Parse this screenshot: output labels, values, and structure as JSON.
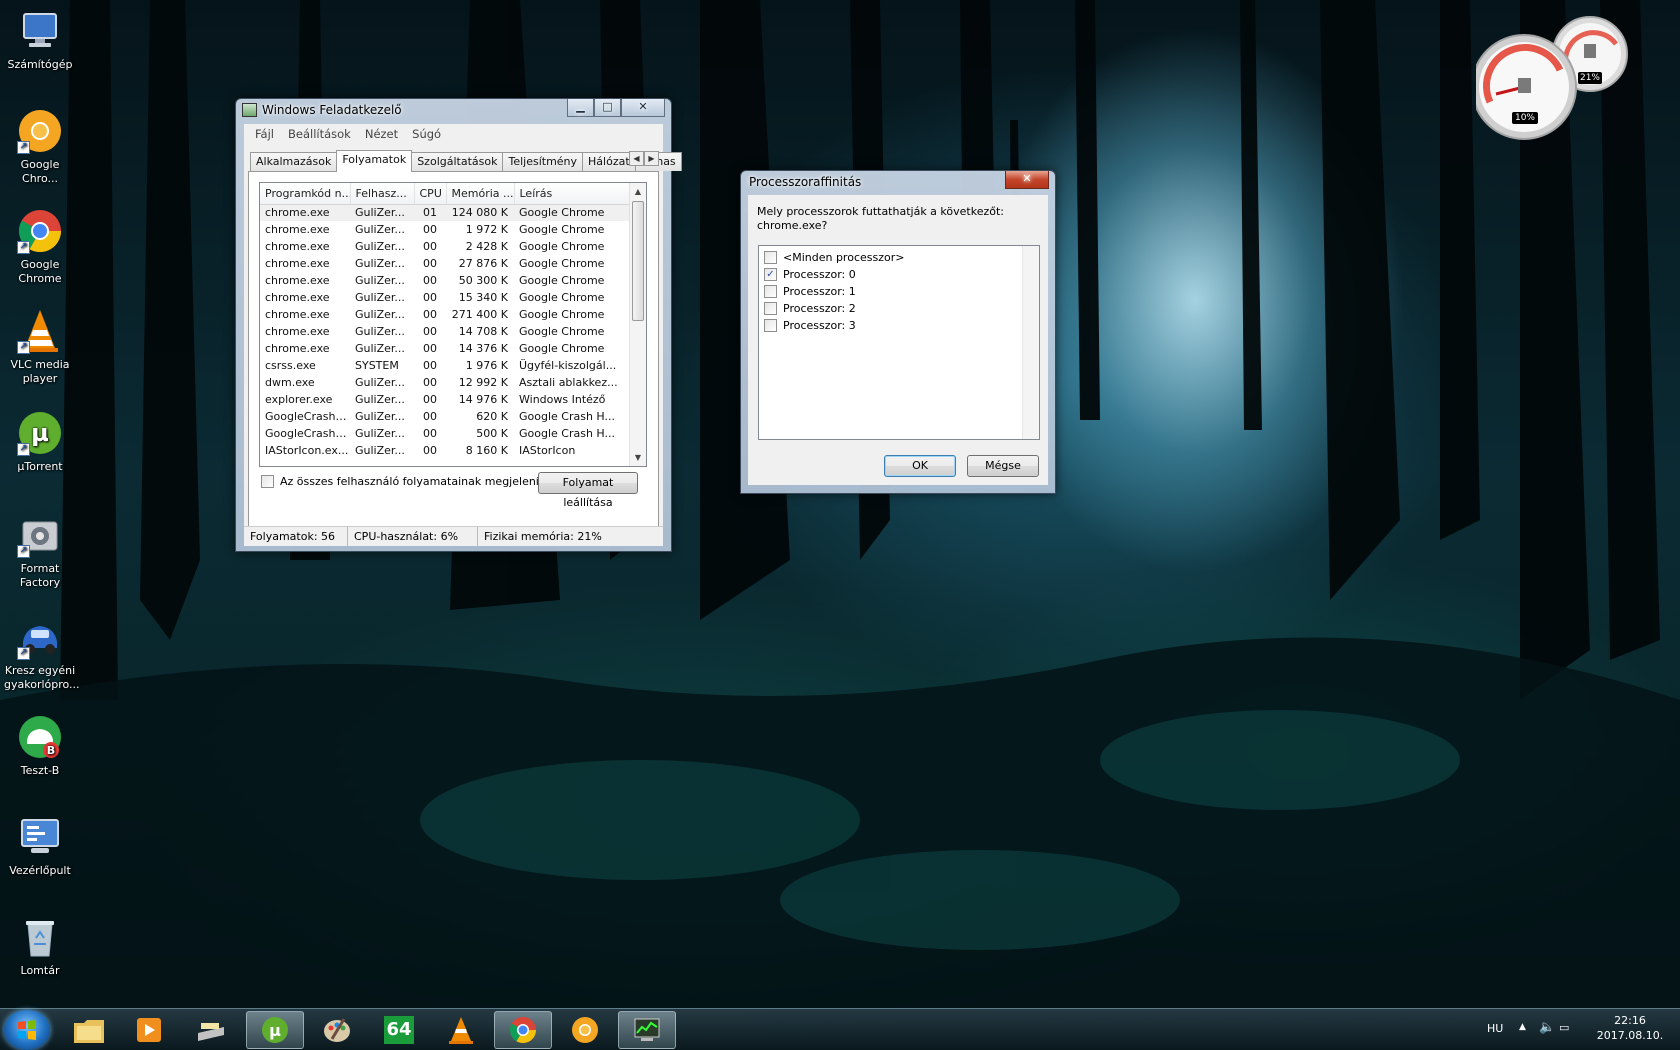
{
  "desktop": {
    "icons": [
      {
        "label": "Számítógép",
        "icon": "computer-icon"
      },
      {
        "label": "Google Chro...",
        "icon": "chrome-canary-icon"
      },
      {
        "label": "Google Chrome",
        "icon": "chrome-icon"
      },
      {
        "label": "VLC media player",
        "icon": "vlc-icon"
      },
      {
        "label": "µTorrent",
        "icon": "utorrent-icon"
      },
      {
        "label": "Format Factory",
        "icon": "format-factory-icon"
      },
      {
        "label": "Kresz egyéni gyakorlópro...",
        "icon": "car-icon"
      },
      {
        "label": "Teszt-B",
        "icon": "test-b-icon"
      },
      {
        "label": "Vezérlőpult",
        "icon": "control-panel-icon"
      },
      {
        "label": "Lomtár",
        "icon": "recycle-bin-icon"
      }
    ]
  },
  "gadget": {
    "cpu_label": "10%",
    "memory_label": "21%",
    "cpu_value": 10,
    "memory_value": 21
  },
  "task_manager": {
    "title": "Windows Feladatkezelő",
    "menu": [
      "Fájl",
      "Beállítások",
      "Nézet",
      "Súgó"
    ],
    "tabs": [
      "Alkalmazások",
      "Folyamatok",
      "Szolgáltatások",
      "Teljesítmény",
      "Hálózat",
      "Felhas"
    ],
    "active_tab": "Folyamatok",
    "columns": [
      "Programkód n...",
      "Felhasz...",
      "CPU",
      "Memória ...",
      "Leírás"
    ],
    "rows": [
      [
        "chrome.exe",
        "GuliZer...",
        "01",
        "124 080 K",
        "Google Chrome"
      ],
      [
        "chrome.exe",
        "GuliZer...",
        "00",
        "1 972 K",
        "Google Chrome"
      ],
      [
        "chrome.exe",
        "GuliZer...",
        "00",
        "2 428 K",
        "Google Chrome"
      ],
      [
        "chrome.exe",
        "GuliZer...",
        "00",
        "27 876 K",
        "Google Chrome"
      ],
      [
        "chrome.exe",
        "GuliZer...",
        "00",
        "50 300 K",
        "Google Chrome"
      ],
      [
        "chrome.exe",
        "GuliZer...",
        "00",
        "15 340 K",
        "Google Chrome"
      ],
      [
        "chrome.exe",
        "GuliZer...",
        "00",
        "271 400 K",
        "Google Chrome"
      ],
      [
        "chrome.exe",
        "GuliZer...",
        "00",
        "14 708 K",
        "Google Chrome"
      ],
      [
        "chrome.exe",
        "GuliZer...",
        "00",
        "14 376 K",
        "Google Chrome"
      ],
      [
        "csrss.exe",
        "SYSTEM",
        "00",
        "1 976 K",
        "Ügyfél-kiszolgál..."
      ],
      [
        "dwm.exe",
        "GuliZer...",
        "00",
        "12 992 K",
        "Asztali ablakkez..."
      ],
      [
        "explorer.exe",
        "GuliZer...",
        "00",
        "14 976 K",
        "Windows Intéző"
      ],
      [
        "GoogleCrashH...",
        "GuliZer...",
        "00",
        "620 K",
        "Google Crash H..."
      ],
      [
        "GoogleCrashH...",
        "GuliZer...",
        "00",
        "500 K",
        "Google Crash H..."
      ],
      [
        "IAStorIcon.ex...",
        "GuliZer...",
        "00",
        "8 160 K",
        "IAStorIcon"
      ]
    ],
    "show_all_label": "Az összes felhasználó folyamatainak megjelenítése",
    "end_process_label": "Folyamat leállítása",
    "status": {
      "processes": "Folyamatok: 56",
      "cpu": "CPU-használat: 6%",
      "memory": "Fizikai memória: 21%"
    }
  },
  "affinity_dialog": {
    "title": "Processzoraffinitás",
    "question": "Mely processzorok futtathatják a következőt: chrome.exe?",
    "items": [
      {
        "label": "<Minden processzor>",
        "checked": false
      },
      {
        "label": "Processzor: 0",
        "checked": true
      },
      {
        "label": "Processzor: 1",
        "checked": false
      },
      {
        "label": "Processzor: 2",
        "checked": false
      },
      {
        "label": "Processzor: 3",
        "checked": false
      }
    ],
    "ok_label": "OK",
    "cancel_label": "Mégse"
  },
  "taskbar": {
    "language": "HU",
    "time": "22:16",
    "date": "2017.08.10.",
    "apps": [
      "explorer",
      "media-player",
      "scanner",
      "utorrent",
      "paint",
      "aida64",
      "vlc",
      "chrome",
      "chrome-canary",
      "task-manager"
    ],
    "aida_label": "64"
  }
}
